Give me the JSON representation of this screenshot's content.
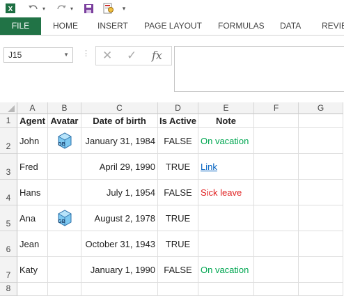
{
  "title_bar": {
    "app_icon": "excel-icon",
    "undo_icon": "undo-icon",
    "redo_icon": "redo-icon",
    "save_icon": "save-icon",
    "print_preview_icon": "print-preview-icon",
    "customize_icon": "customize-qat-icon"
  },
  "ribbon": {
    "tabs": [
      {
        "label": "FILE"
      },
      {
        "label": "HOME"
      },
      {
        "label": "INSERT"
      },
      {
        "label": "PAGE LAYOUT"
      },
      {
        "label": "FORMULAS"
      },
      {
        "label": "DATA"
      },
      {
        "label": "REVIEW"
      }
    ]
  },
  "formula_bar": {
    "name_box": "J15",
    "formula": "",
    "cancel_icon": "✕",
    "enter_icon": "✓",
    "fx_label": "fx"
  },
  "sheet": {
    "columns": [
      "A",
      "B",
      "C",
      "D",
      "E",
      "F",
      "G"
    ],
    "rows": [
      "1",
      "2",
      "3",
      "4",
      "5",
      "6",
      "7",
      "8"
    ],
    "headers": [
      "Agent",
      "Avatar",
      "Date of birth",
      "Is Active",
      "Note"
    ],
    "records": [
      {
        "agent": "John",
        "avatar": true,
        "dob": "January 31, 1984",
        "active": "FALSE",
        "note": "On vacation",
        "note_style": "green"
      },
      {
        "agent": "Fred",
        "avatar": false,
        "dob": "April 29, 1990",
        "active": "TRUE",
        "note": "Link",
        "note_style": "link"
      },
      {
        "agent": "Hans",
        "avatar": false,
        "dob": "July 1, 1954",
        "active": "FALSE",
        "note": "Sick leave",
        "note_style": "red"
      },
      {
        "agent": "Ana",
        "avatar": true,
        "dob": "August 2, 1978",
        "active": "TRUE",
        "note": "",
        "note_style": ""
      },
      {
        "agent": "Jean",
        "avatar": false,
        "dob": "October 31, 1943",
        "active": "TRUE",
        "note": "",
        "note_style": ""
      },
      {
        "agent": "Katy",
        "avatar": false,
        "dob": "January 1, 1990",
        "active": "FALSE",
        "note": "On vacation",
        "note_style": "green"
      }
    ],
    "avatar_text": "GB"
  },
  "colors": {
    "file_tab": "#217346",
    "note_green": "#00a651",
    "note_red": "#e02020",
    "link": "#0563c1"
  }
}
